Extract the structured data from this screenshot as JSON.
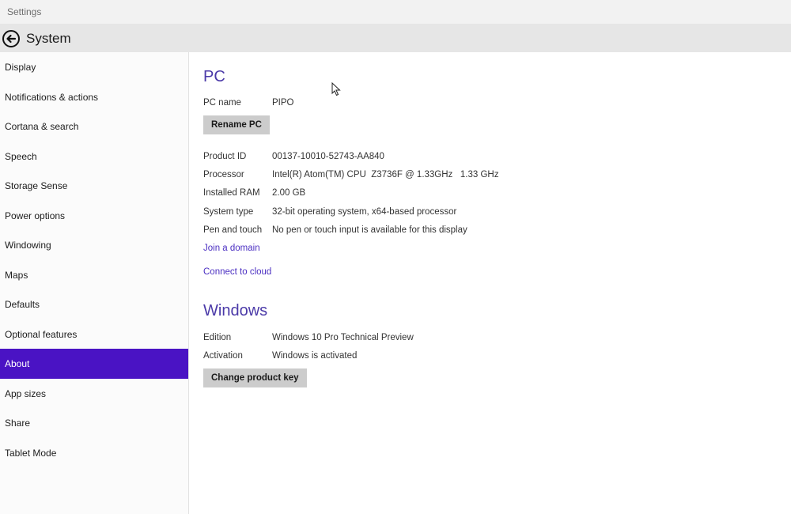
{
  "window": {
    "title": "Settings"
  },
  "header": {
    "title": "System"
  },
  "sidebar": {
    "items": [
      {
        "label": "Display"
      },
      {
        "label": "Notifications & actions"
      },
      {
        "label": "Cortana & search"
      },
      {
        "label": "Speech"
      },
      {
        "label": "Storage Sense"
      },
      {
        "label": "Power options"
      },
      {
        "label": "Windowing"
      },
      {
        "label": "Maps"
      },
      {
        "label": "Defaults"
      },
      {
        "label": "Optional features"
      },
      {
        "label": "About",
        "selected": true
      },
      {
        "label": "App sizes"
      },
      {
        "label": "Share"
      },
      {
        "label": "Tablet Mode"
      }
    ]
  },
  "pc": {
    "heading": "PC",
    "pc_name_label": "PC name",
    "pc_name_value": "PIPO",
    "rename_button": "Rename PC",
    "specs": [
      {
        "label": "Product ID",
        "value": "00137-10010-52743-AA840"
      },
      {
        "label": "Processor",
        "value": "Intel(R) Atom(TM) CPU  Z3736F @ 1.33GHz   1.33 GHz"
      },
      {
        "label": "Installed RAM",
        "value": "2.00 GB"
      },
      {
        "label": "System type",
        "value": "32-bit operating system, x64-based processor"
      },
      {
        "label": "Pen and touch",
        "value": "No pen or touch input is available for this display"
      }
    ],
    "join_domain_link": "Join a domain",
    "connect_cloud_link": "Connect to cloud"
  },
  "windows": {
    "heading": "Windows",
    "edition_label": "Edition",
    "edition_value": "Windows 10 Pro Technical Preview",
    "activation_label": "Activation",
    "activation_value": "Windows is activated",
    "change_key_button": "Change product key"
  },
  "colors": {
    "accent": "#4a13c4",
    "heading": "#4b3aa8",
    "link": "#4b2fc2",
    "button_bg": "#cccccc"
  },
  "icons": {
    "back": "back-arrow-circle-icon",
    "cursor": "mouse-pointer-icon"
  }
}
